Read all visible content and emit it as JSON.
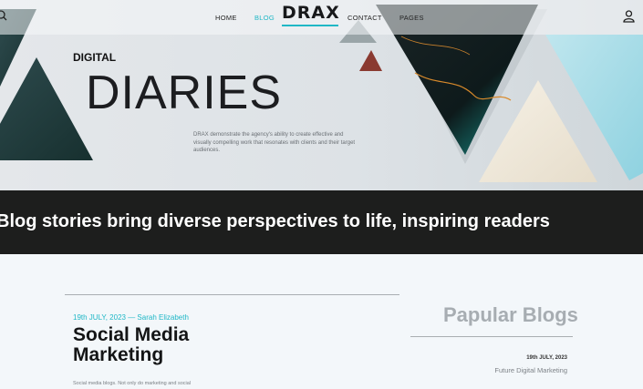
{
  "nav": {
    "links": [
      "HOME",
      "BLOG",
      "CONTACT",
      "PAGES"
    ],
    "active": "BLOG",
    "logo": "DRAX",
    "search_icon": "search-icon",
    "user_icon": "user-icon"
  },
  "hero": {
    "kicker": "DIGITAL",
    "title": "DIARIES",
    "description": "DRAX demonstrate the agency's ability to create effective and visually compelling work that resonates with clients and their target audiences."
  },
  "banner": {
    "text": "Blog stories bring diverse perspectives to life, inspiring readers"
  },
  "post": {
    "meta": "19th JULY, 2023 — Sarah Elizabeth",
    "title_line1": "Social Media",
    "title_line2": "Marketing",
    "excerpt": "Social media blogs. Not only do marketing and social"
  },
  "sidebar": {
    "heading": "Papular Blogs",
    "items": [
      {
        "date": "19th JULY, 2023",
        "title": "Future Digital Marketing"
      }
    ]
  },
  "colors": {
    "accent": "#1fb7c6",
    "banner_bg": "#1d1e1d",
    "page_bg": "#f3f7fa"
  }
}
